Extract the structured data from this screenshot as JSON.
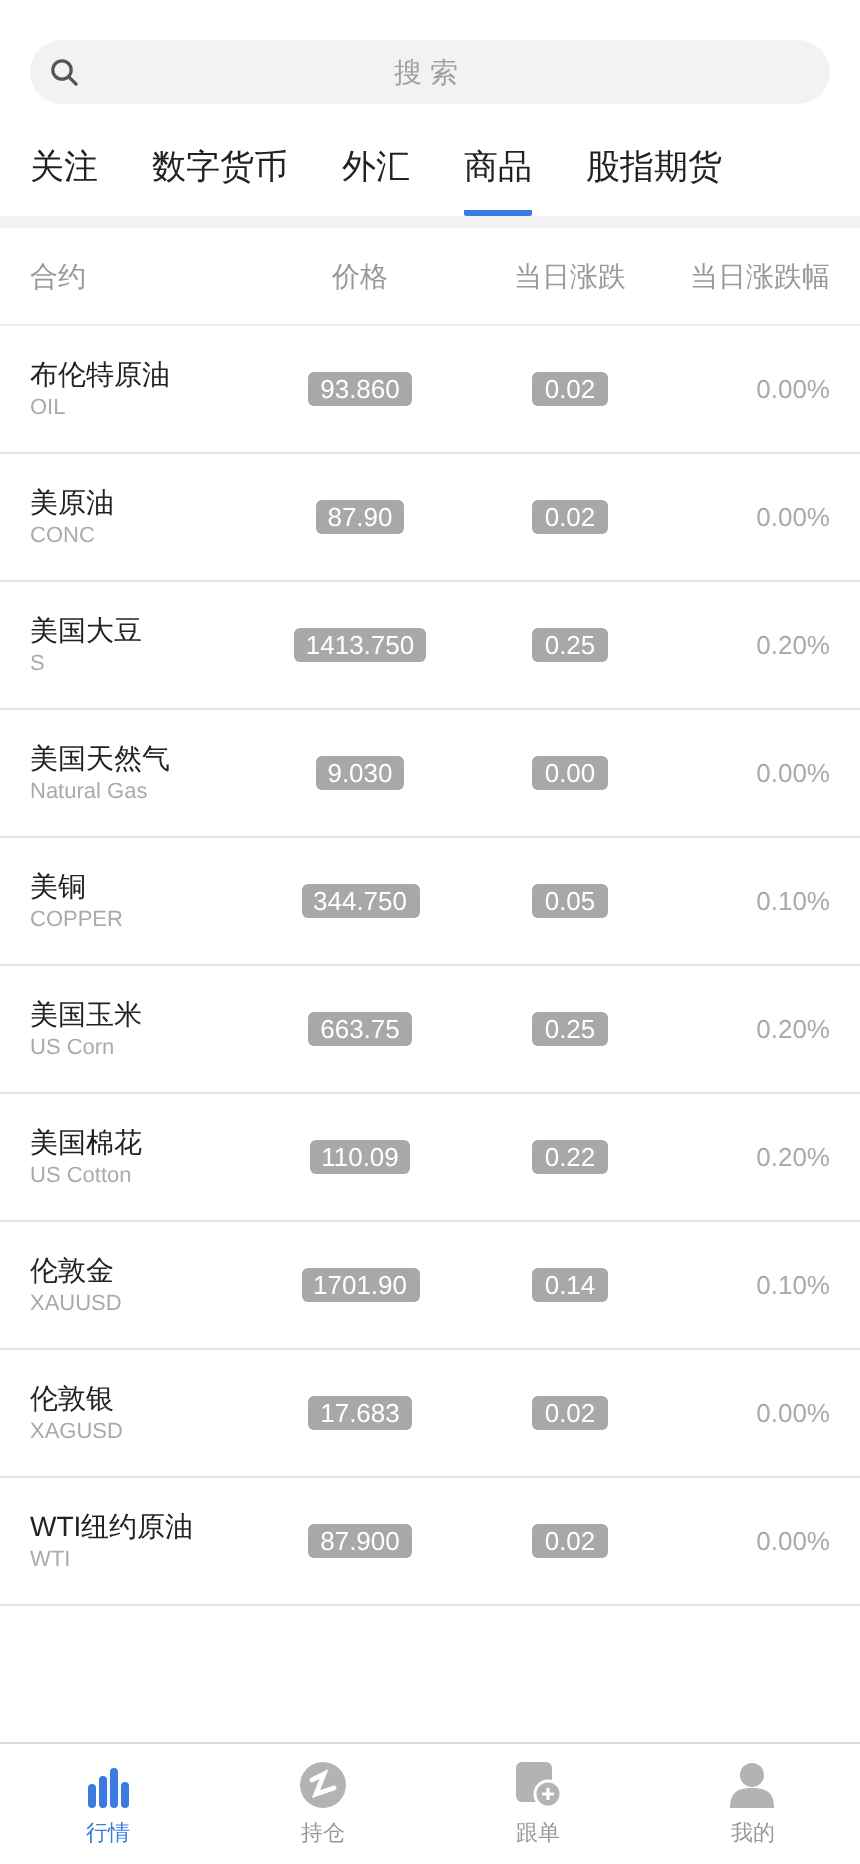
{
  "search": {
    "placeholder": "搜索"
  },
  "tabs": [
    {
      "label": "关注",
      "selected": false
    },
    {
      "label": "数字货币",
      "selected": false
    },
    {
      "label": "外汇",
      "selected": false
    },
    {
      "label": "商品",
      "selected": true
    },
    {
      "label": "股指期货",
      "selected": false
    }
  ],
  "table": {
    "columns": [
      "合约",
      "价格",
      "当日涨跌",
      "当日涨跌幅"
    ],
    "rows": [
      {
        "name": "布伦特原油",
        "code": "OIL",
        "price": "93.860",
        "change": "0.02",
        "percent": "0.00%"
      },
      {
        "name": "美原油",
        "code": "CONC",
        "price": "87.90",
        "change": "0.02",
        "percent": "0.00%"
      },
      {
        "name": "美国大豆",
        "code": "S",
        "price": "1413.750",
        "change": "0.25",
        "percent": "0.20%"
      },
      {
        "name": "美国天然气",
        "code": "Natural Gas",
        "price": "9.030",
        "change": "0.00",
        "percent": "0.00%"
      },
      {
        "name": "美铜",
        "code": "COPPER",
        "price": "344.750",
        "change": "0.05",
        "percent": "0.10%"
      },
      {
        "name": "美国玉米",
        "code": "US Corn",
        "price": "663.75",
        "change": "0.25",
        "percent": "0.20%"
      },
      {
        "name": "美国棉花",
        "code": "US Cotton",
        "price": "110.09",
        "change": "0.22",
        "percent": "0.20%"
      },
      {
        "name": "伦敦金",
        "code": "XAUUSD",
        "price": "1701.90",
        "change": "0.14",
        "percent": "0.10%"
      },
      {
        "name": "伦敦银",
        "code": "XAGUSD",
        "price": "17.683",
        "change": "0.02",
        "percent": "0.00%"
      },
      {
        "name": "WTI纽约原油",
        "code": "WTI",
        "price": "87.900",
        "change": "0.02",
        "percent": "0.00%"
      }
    ]
  },
  "bottom_nav": [
    {
      "kind": "chart",
      "label": "行情",
      "selected": true
    },
    {
      "kind": "position",
      "label": "持仓",
      "selected": false
    },
    {
      "kind": "follow",
      "label": "跟单",
      "selected": false
    },
    {
      "kind": "user",
      "label": "我的",
      "selected": false
    }
  ]
}
